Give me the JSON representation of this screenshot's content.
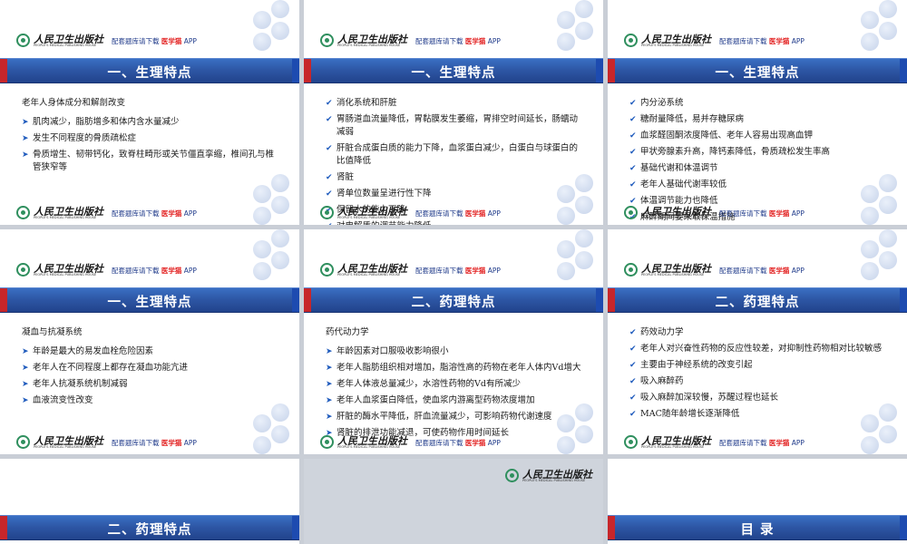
{
  "brand": {
    "name_cn": "人民卫生出版社",
    "name_en": "PEOPLE'S MEDICAL PUBLISHING HOUSE",
    "tagline_prefix": "配套题库请下载",
    "tagline_highlight": "医学猫",
    "tagline_suffix": "APP"
  },
  "slides": [
    {
      "title": "一、生理特点",
      "marker": "arrow",
      "heading": "老年人身体成分和解剖改变",
      "bullets": [
        "肌肉减少，脂肪增多和体内含水量减少",
        "发生不同程度的骨质疏松症",
        "骨质增生、韧带钙化，致脊柱畸形或关节僵直挛缩，椎间孔与椎管狭窄等"
      ]
    },
    {
      "title": "一、生理特点",
      "marker": "check",
      "bullets": [
        "消化系统和肝脏",
        "胃肠道血流量降低，胃黏膜发生萎缩，胃排空时间延长，肠蠕动减弱",
        "肝脏合成蛋白质的能力下降，血浆蛋白减少，白蛋白与球蛋白的比值降低",
        "肾脏",
        "肾单位数量呈进行性下降",
        "保留水的能力下降",
        "对电解质的调节能力降低"
      ]
    },
    {
      "title": "一、生理特点",
      "marker": "check",
      "bullets": [
        "内分泌系统",
        "糖耐量降低，易并存糖尿病",
        "血浆醛固酮浓度降低、老年人容易出现高血钾",
        "甲状旁腺素升高，降钙素降低，骨质疏松发生率高",
        "基础代谢和体温调节",
        "老年人基础代谢率较低",
        "体温调节能力也降低",
        "麻醉期间要采取保温措施"
      ]
    },
    {
      "title": "一、生理特点",
      "marker": "arrow",
      "heading": "凝血与抗凝系统",
      "bullets": [
        "年龄是最大的易发血栓危险因素",
        "老年人在不同程度上都存在凝血功能亢进",
        "老年人抗凝系统机制减弱",
        "血液流变性改变"
      ]
    },
    {
      "title": "二、药理特点",
      "marker": "arrow",
      "heading": "药代动力学",
      "bullets": [
        "年龄因素对口服吸收影响很小",
        "老年人脂肪组织相对增加，脂溶性高的药物在老年人体内Vd增大",
        "老年人体液总量减少，水溶性药物的Vd有所减少",
        "老年人血浆蛋白降低，使血浆内游离型药物浓度增加",
        "肝脏的酶水平降低，肝血流量减少，可影响药物代谢速度",
        "肾脏的排泄功能减退，可使药物作用时间延长"
      ]
    },
    {
      "title": "二、药理特点",
      "marker": "check",
      "bullets": [
        "药效动力学",
        "老年人对兴奋性药物的反应性较差，对抑制性药物相对比较敏感",
        "主要由于神经系统的改变引起",
        "吸入麻醉药",
        "吸入麻醉加深较慢，苏醒过程也延长",
        "MAC随年龄增长逐渐降低"
      ]
    },
    {
      "title": "二、药理特点"
    },
    {},
    {
      "title": "目  录"
    }
  ]
}
